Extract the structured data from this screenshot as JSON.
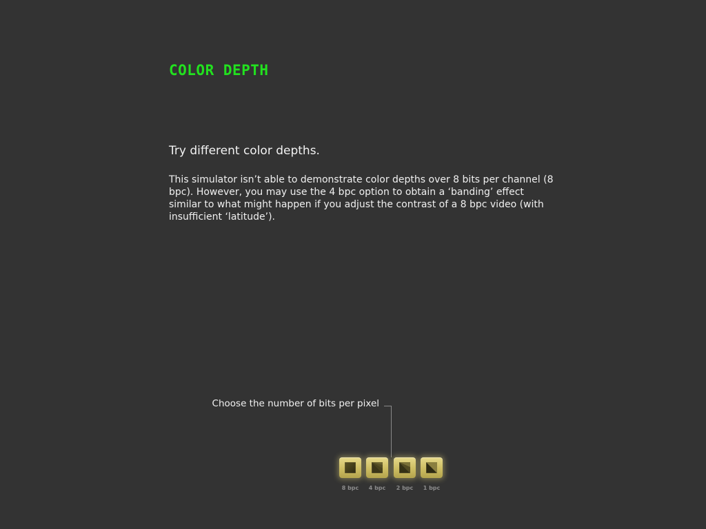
{
  "page": {
    "title": "COLOR DEPTH",
    "subheading": "Try different color depths.",
    "description": "This simulator isn’t able to demonstrate color depths over 8 bits per channel (8 bpc). However, you may use the 4 bpc option to obtain a ‘banding’ effect similar to what might happen if you adjust the contrast of a 8 bpc video (with insufficient ‘latitude’).",
    "title_color": "#22e11f",
    "background_color": "#333333"
  },
  "control": {
    "prompt": "Choose the number of bits per pixel",
    "options": [
      {
        "label": "8 bpc",
        "icon": "gradient-square-icon"
      },
      {
        "label": "4 bpc",
        "icon": "banded-square-icon"
      },
      {
        "label": "2 bpc",
        "icon": "striped-square-icon"
      },
      {
        "label": "1 bpc",
        "icon": "split-square-icon"
      }
    ],
    "button_color": "#cdbd62"
  }
}
